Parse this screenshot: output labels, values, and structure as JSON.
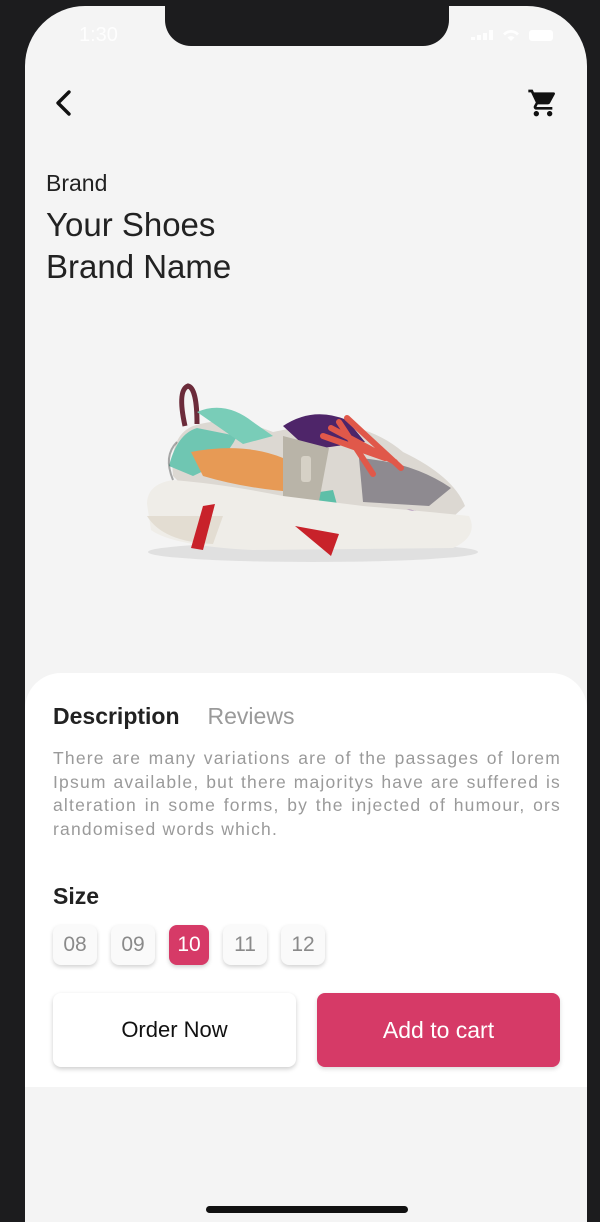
{
  "status_bar": {
    "time": "1:30"
  },
  "header": {
    "back_icon": "chevron-left-icon",
    "cart_icon": "shopping-cart-icon"
  },
  "product": {
    "brand_label": "Brand",
    "name_line1": "Your Shoes",
    "name_line2": "Brand Name",
    "image": "sneaker-image"
  },
  "details": {
    "tabs": [
      {
        "label": "Description",
        "active": true
      },
      {
        "label": "Reviews",
        "active": false
      }
    ],
    "description": "There are many variations are of the passages of lorem Ipsum available, but there majoritys have are suffered is alteration in some forms, by the injected of humour, ors randomised words which.",
    "size_title": "Size",
    "sizes": [
      "08",
      "09",
      "10",
      "11",
      "12"
    ],
    "selected_size": "10"
  },
  "actions": {
    "order_label": "Order Now",
    "cart_label": "Add to cart"
  },
  "colors": {
    "accent": "#d63a67",
    "background": "#f4f4f4",
    "sheet": "#ffffff"
  }
}
